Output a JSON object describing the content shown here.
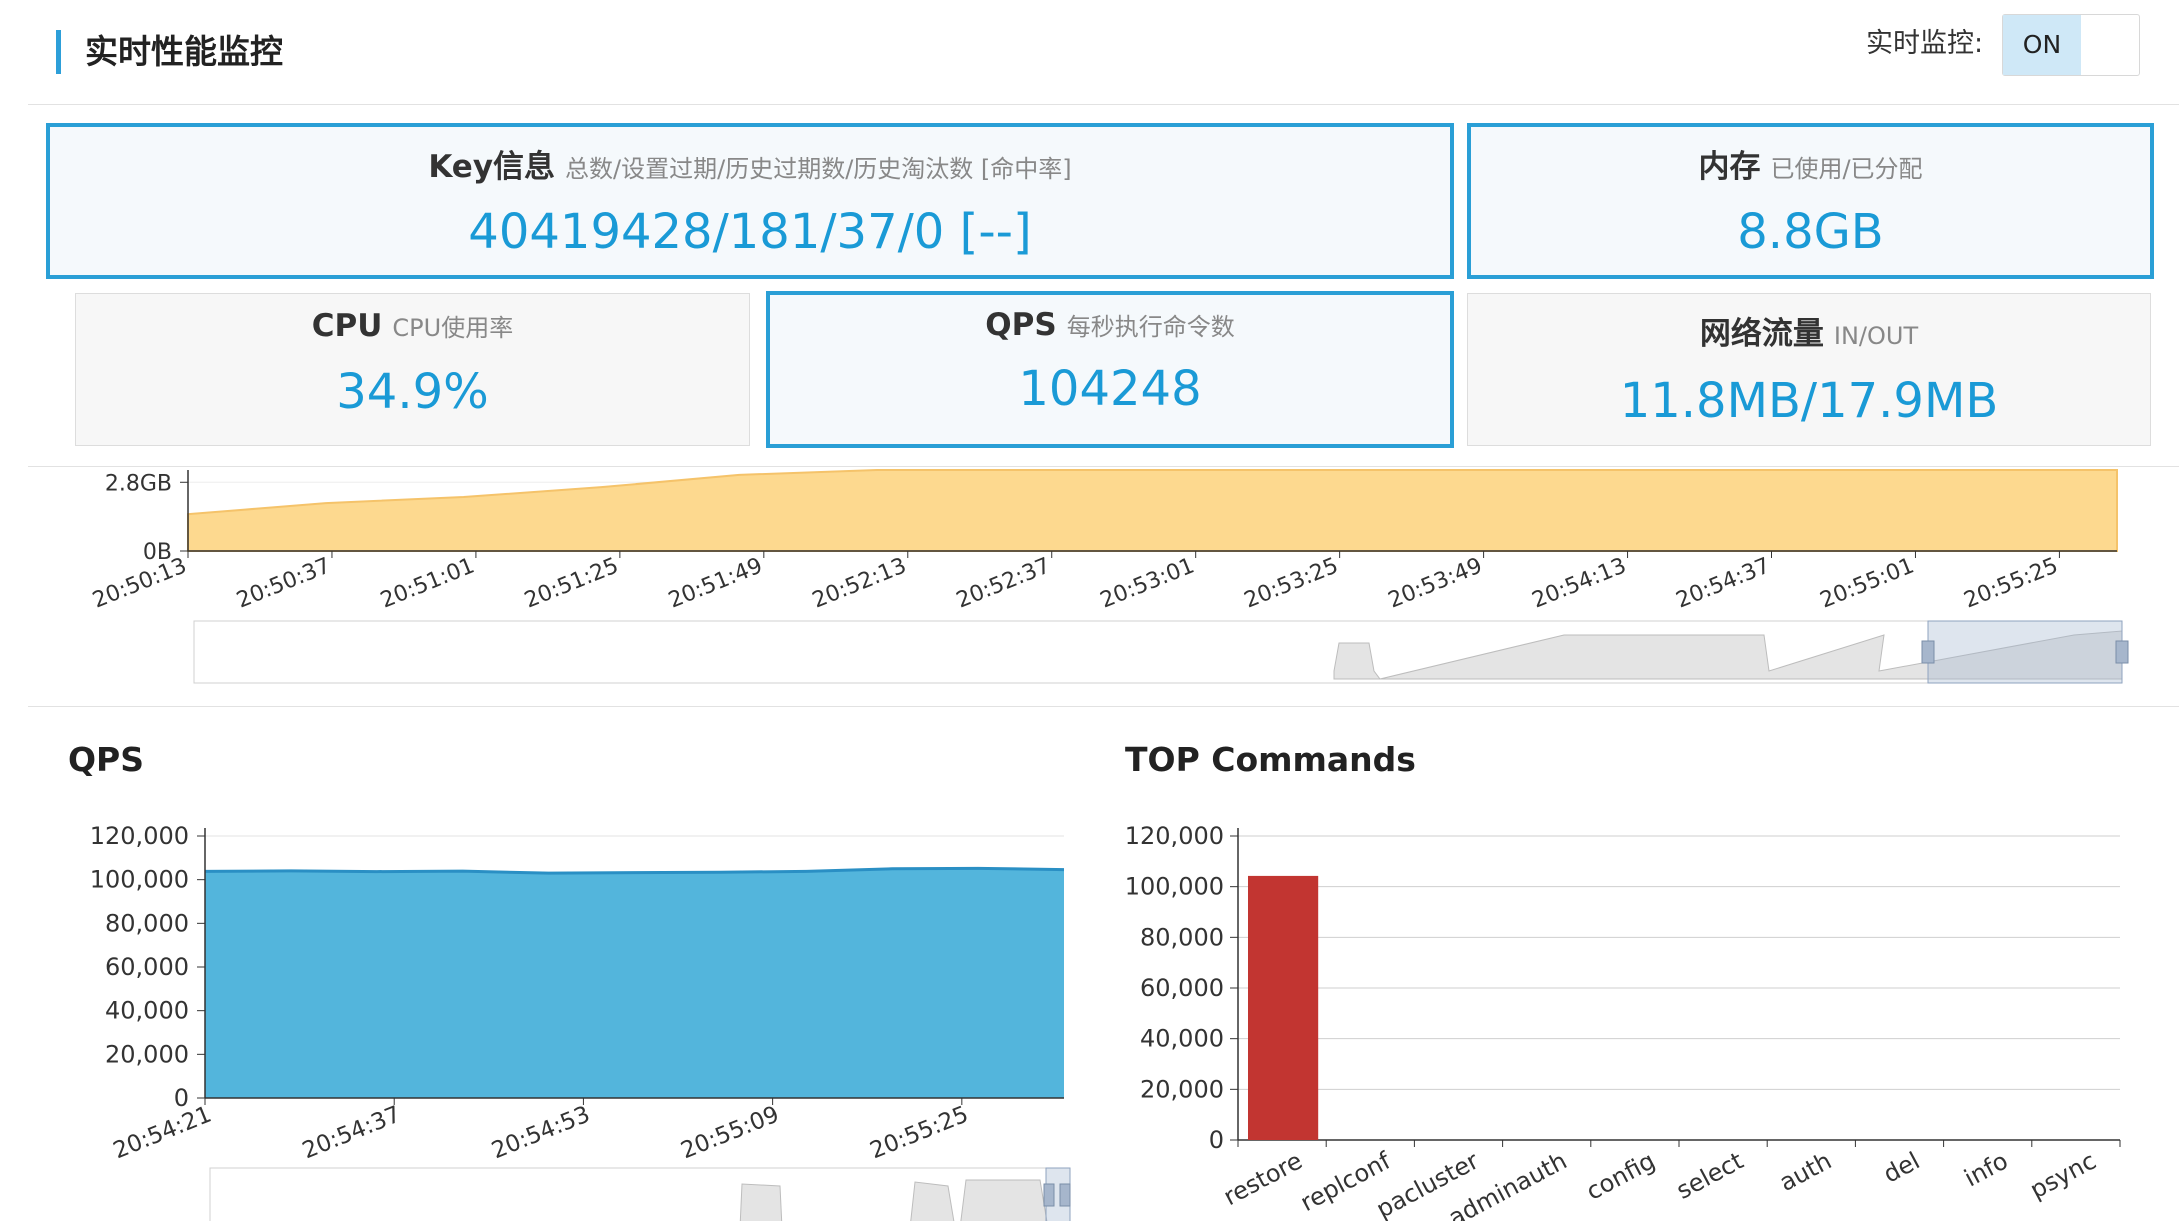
{
  "header": {
    "title": "实时性能监控",
    "realtime_label": "实时监控:",
    "toggle_on": "ON"
  },
  "cards": {
    "key": {
      "title": "Key信息",
      "subtitle": "总数/设置过期/历史过期数/历史淘汰数 [命中率]",
      "value": "40419428/181/37/0 [--]"
    },
    "memory": {
      "title": "内存",
      "subtitle": "已使用/已分配",
      "value": "8.8GB"
    },
    "cpu": {
      "title": "CPU",
      "subtitle": "CPU使用率",
      "value": "34.9%"
    },
    "qps": {
      "title": "QPS",
      "subtitle": "每秒执行命令数",
      "value": "104248"
    },
    "network": {
      "title": "网络流量",
      "subtitle": "IN/OUT",
      "value": "11.8MB/17.9MB"
    }
  },
  "colors": {
    "accent": "#2a9fd6",
    "memory_fill": "#fdd98f",
    "qps_fill": "#53b5dc",
    "bar": "#c23531"
  },
  "panels": {
    "qps_title": "QPS",
    "top_title": "TOP Commands"
  },
  "chart_data": [
    {
      "type": "area",
      "y_tick_labels": [
        "2.8GB",
        "0B"
      ],
      "x_tick_labels": [
        "20:50:13",
        "20:50:37",
        "20:51:01",
        "20:51:25",
        "20:51:49",
        "20:52:13",
        "20:52:37",
        "20:53:01",
        "20:53:25",
        "20:53:49",
        "20:54:13",
        "20:54:37",
        "20:55:01",
        "20:55:25"
      ],
      "y_unit": "GB",
      "ylim": [
        0,
        2.8
      ],
      "x": [
        "20:50:13",
        "20:50:37",
        "20:51:01",
        "20:51:25",
        "20:51:49",
        "20:52:13",
        "20:52:37",
        "20:53:01",
        "20:53:25",
        "20:53:49",
        "20:54:13",
        "20:54:37",
        "20:55:01",
        "20:55:25",
        "20:55:37"
      ],
      "values": [
        1.5,
        1.95,
        2.2,
        2.6,
        3.1,
        3.3,
        3.3,
        3.3,
        3.3,
        3.3,
        3.3,
        3.3,
        3.3,
        3.3,
        3.3
      ],
      "grid": true,
      "data_zoom": true
    },
    {
      "type": "area",
      "title": "QPS",
      "x_tick_labels": [
        "20:54:21",
        "20:54:37",
        "20:54:53",
        "20:55:09",
        "20:55:25"
      ],
      "y_tick_labels": [
        "120,000",
        "100,000",
        "80,000",
        "60,000",
        "40,000",
        "20,000",
        "0"
      ],
      "ylim": [
        0,
        120000
      ],
      "x": [
        "20:54:21",
        "20:54:29",
        "20:54:37",
        "20:54:45",
        "20:54:53",
        "20:55:01",
        "20:55:09",
        "20:55:17",
        "20:55:25",
        "20:55:33",
        "20:55:37"
      ],
      "values": [
        103800,
        104000,
        103700,
        103900,
        103000,
        103200,
        103400,
        103800,
        105000,
        105200,
        104600
      ],
      "grid": true,
      "data_zoom": true
    },
    {
      "type": "bar",
      "title": "TOP Commands",
      "categories": [
        "restore",
        "replconf",
        "pacluster",
        "adminauth",
        "config",
        "select",
        "auth",
        "del",
        "info",
        "psync"
      ],
      "values": [
        104248,
        0,
        0,
        0,
        0,
        0,
        0,
        0,
        0,
        0
      ],
      "y_tick_labels": [
        "120,000",
        "100,000",
        "80,000",
        "60,000",
        "40,000",
        "20,000",
        "0"
      ],
      "ylim": [
        0,
        120000
      ],
      "grid": true
    }
  ]
}
